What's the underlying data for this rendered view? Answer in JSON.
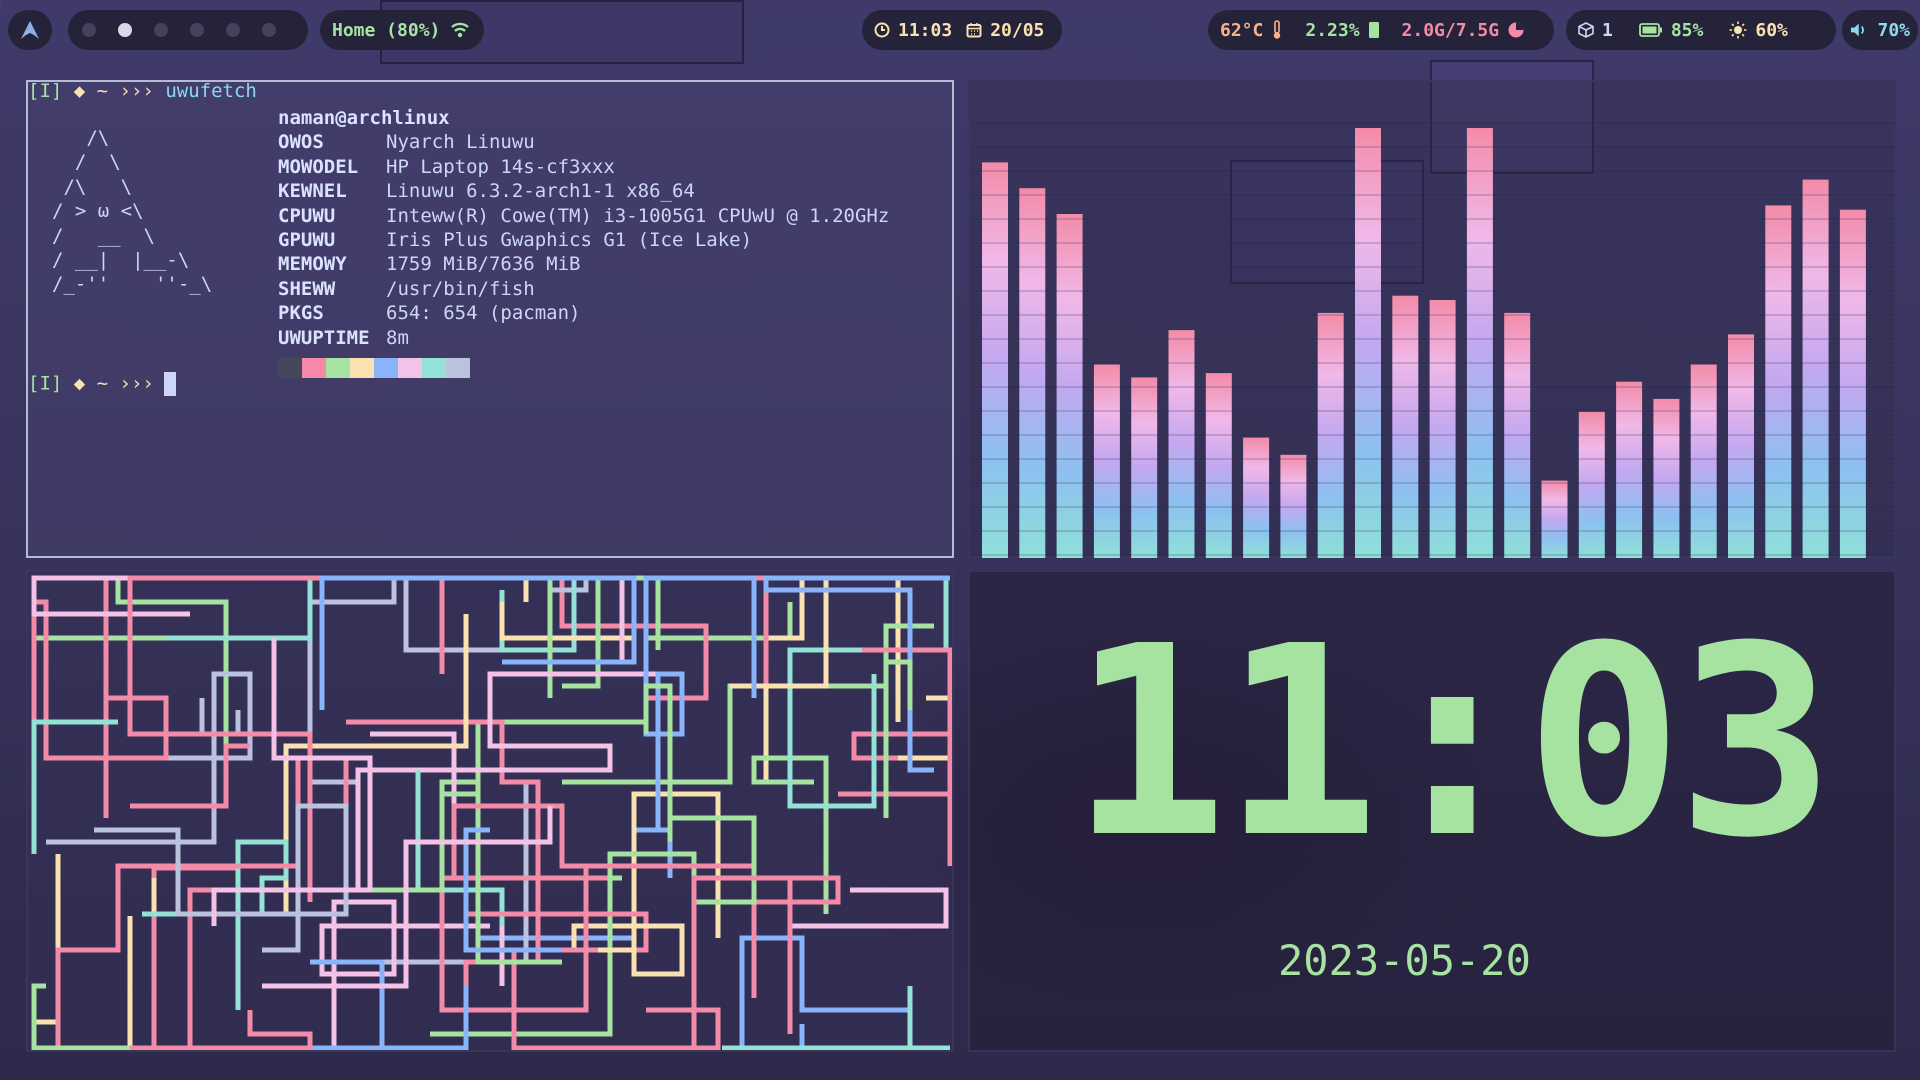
{
  "bar": {
    "launcher_icon": "arch-logo-icon",
    "workspaces": [
      {
        "active": false
      },
      {
        "active": true
      },
      {
        "active": false
      },
      {
        "active": false
      },
      {
        "active": false
      },
      {
        "active": false
      }
    ],
    "network_label": "Home (80%)",
    "network_icon": "wifi-icon",
    "clock_time": "11:03",
    "clock_icon": "clock-icon",
    "calendar_date": "20/05",
    "calendar_icon": "calendar-icon",
    "cpu_temp": "62°C",
    "temp_icon": "thermometer-icon",
    "cpu_usage": "2.23%",
    "cpu_icon": "cpu-chip-icon",
    "memory": "2.0G/7.5G",
    "memory_icon": "pie-chart-icon",
    "updates_count": "1",
    "updates_icon": "package-icon",
    "battery": "85%",
    "battery_icon": "battery-icon",
    "brightness": "60%",
    "brightness_icon": "sun-icon",
    "volume": "70%",
    "volume_icon": "speaker-icon"
  },
  "terminal": {
    "prompt_prefix": "[I]",
    "prompt_symbol": "◆ ~ ›››",
    "command": "uwufetch",
    "ascii_art": "   /\\\n  /  \\\n /\\   \\\n/ > ω <\\\n/   __  \\\n/ __|  |__-\\\n/_-''    ''-_\\",
    "userhost": "naman@archlinux",
    "info": [
      {
        "key": "OWOS",
        "value": "Nyarch Linuwu"
      },
      {
        "key": "MOWODEL",
        "value": "HP Laptop 14s-cf3xxx"
      },
      {
        "key": "KEWNEL",
        "value": "Linuwu 6.3.2-arch1-1 x86_64"
      },
      {
        "key": "CPUWU",
        "value": "Inteww(R) Cowe(TM) i3-1005G1 CPUwU @ 1.20GHz"
      },
      {
        "key": "GPUWU",
        "value": "Iris Plus Gwaphics G1 (Ice Lake)"
      },
      {
        "key": "MEMOWY",
        "value": "1759 MiB/7636 MiB"
      },
      {
        "key": "SHEWW",
        "value": "/usr/bin/fish"
      },
      {
        "key": "PKGS",
        "value": "654: 654 (pacman)"
      },
      {
        "key": "UWUPTIME",
        "value": "8m"
      }
    ],
    "palette": [
      "#45475a",
      "#f38ba8",
      "#a6e3a1",
      "#f9e2af",
      "#89b4fa",
      "#f5c2e7",
      "#94e2d5",
      "#bac2de"
    ]
  },
  "visualizer": {
    "bar_levels": [
      0.92,
      0.86,
      0.8,
      0.45,
      0.42,
      0.53,
      0.43,
      0.28,
      0.24,
      0.57,
      1.0,
      0.61,
      0.6,
      1.0,
      0.57,
      0.18,
      0.34,
      0.41,
      0.37,
      0.45,
      0.52,
      0.82,
      0.88,
      0.81
    ],
    "gradient": [
      "#8fe0d8",
      "#8dc0f0",
      "#c3a8f0",
      "#f0b8e8",
      "#f38ba8"
    ]
  },
  "pipes": {
    "colors": [
      "#a6e3a1",
      "#f38ba8",
      "#94e2d5",
      "#f9e2af",
      "#f5c2e7",
      "#bac2de",
      "#89b4fa"
    ]
  },
  "clock": {
    "time": "11:03",
    "date": "2023-05-20"
  }
}
